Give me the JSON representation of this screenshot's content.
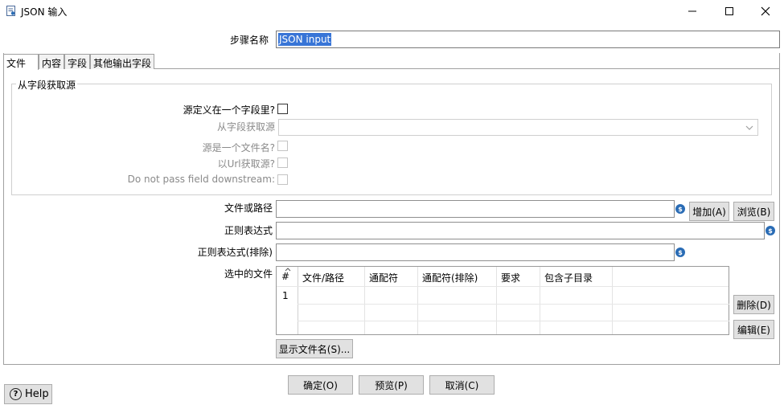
{
  "window": {
    "title": "JSON 输入",
    "icons": {
      "app": "json-input-icon",
      "minimize": "minimize-icon",
      "maximize": "maximize-icon",
      "close": "close-icon"
    }
  },
  "step_name": {
    "label": "步骤名称",
    "value": "JSON input"
  },
  "tabs": [
    {
      "label": "文件",
      "active": true
    },
    {
      "label": "内容",
      "active": false
    },
    {
      "label": "字段",
      "active": false
    },
    {
      "label": "其他输出字段",
      "active": false
    }
  ],
  "source_group": {
    "title": "从字段获取源",
    "source_in_field_label": "源定义在一个字段里?",
    "source_in_field_checked": false,
    "get_source_from_field_label": "从字段获取源",
    "get_source_from_field_value": "",
    "source_is_filename_label": "源是一个文件名?",
    "source_is_filename_checked": false,
    "read_url_label": "以Url获取源?",
    "read_url_checked": false,
    "do_not_pass_label": "Do not pass field downstream:",
    "do_not_pass_checked": false
  },
  "file_section": {
    "file_or_dir_label": "文件或路径",
    "file_or_dir_value": "",
    "add_button": "增加(A)",
    "browse_button": "浏览(B)",
    "regex_label": "正则表达式",
    "regex_value": "",
    "exclude_regex_label": "正则表达式(排除)",
    "exclude_regex_value": "",
    "selected_files_label": "选中的文件",
    "table": {
      "columns": [
        "#",
        "文件/路径",
        "通配符",
        "通配符(排除)",
        "要求",
        "包含子目录"
      ],
      "rows": [
        {
          "num": "1",
          "cells": [
            "",
            "",
            "",
            "",
            ""
          ]
        }
      ]
    },
    "delete_button": "删除(D)",
    "edit_button": "编辑(E)",
    "show_filenames_button": "显示文件名(S)..."
  },
  "footer": {
    "help_label": "Help",
    "ok_button": "确定(O)",
    "preview_button": "预览(P)",
    "cancel_button": "取消(C)"
  },
  "colors": {
    "selection": "#3875d7",
    "variable_icon": "#2a6cb5",
    "button_bg": "#e1e1e1",
    "border": "#a0a0a0"
  }
}
